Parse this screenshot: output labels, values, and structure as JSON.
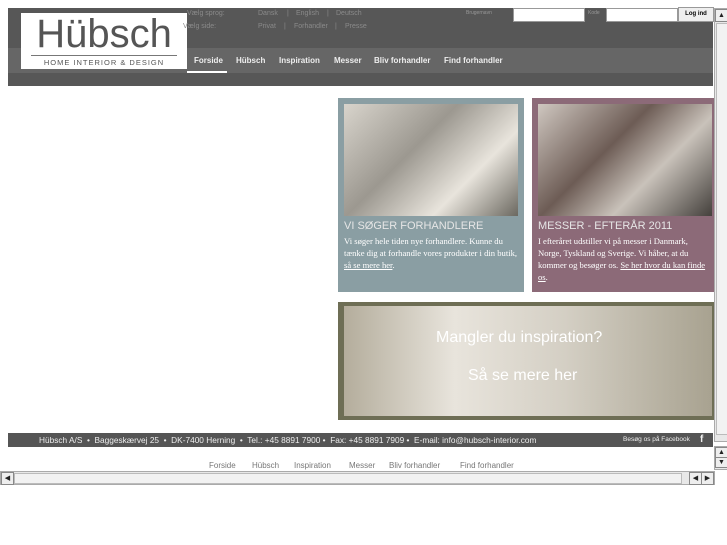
{
  "logo": {
    "name": "Hübsch",
    "tagline": "HOME INTERIOR & DESIGN"
  },
  "top": {
    "lang_label": "Vælg sprog:",
    "languages": [
      "Dansk",
      "English",
      "Deutsch"
    ],
    "side_label": "Vælg side:",
    "sides": [
      "Privat",
      "Forhandler",
      "Presse"
    ],
    "user_label": "Brugernavn",
    "pass_label": "Kode",
    "login": "Log ind",
    "sep": "|"
  },
  "nav": [
    "Forside",
    "Hübsch",
    "Inspiration",
    "Messer",
    "Bliv forhandler",
    "Find forhandler"
  ],
  "cards": [
    {
      "title": "VI SØGER FORHANDLERE",
      "text": "Vi søger hele tiden nye forhandlere. Kunne du tænke dig at forhandle vores produkter i din butik, ",
      "link": "så se mere her",
      "end": ".",
      "bg": "#8a9ea3"
    },
    {
      "title": "MESSER - EFTERÅR 2011",
      "text": "I efteråret udstiller vi på messer i Danmark, Norge, Tyskland og Sverige. Vi håber, at du kommer og besøger os. ",
      "link": "Se her hvor du kan finde os",
      "end": ".",
      "bg": "#8c6a78"
    }
  ],
  "banner": {
    "line1": "Mangler du inspiration?",
    "line2": "Så se mere her"
  },
  "footer": {
    "address": "Hübsch A/S  •  Baggeskærvej 25  •  DK-7400 Herning  •  Tel.: +45 8891 7900 •  Fax: +45 8891 7909 •  E-mail: info@hubsch-interior.com",
    "facebook": "Besøg os på Facebook",
    "fb_icon": "f"
  }
}
